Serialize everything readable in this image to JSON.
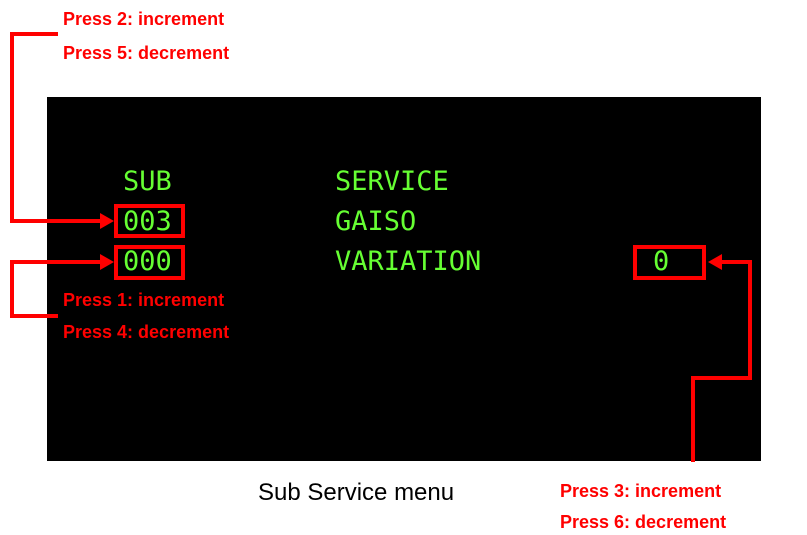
{
  "colors": {
    "screen_background": "#000000",
    "screen_text": "#66ff33",
    "annotation": "#ff0000",
    "caption": "#000000"
  },
  "screen": {
    "column_sub_header": "SUB",
    "column_service_header": "SERVICE",
    "sub_value_1": "003",
    "service_item_1": "GAISO",
    "sub_value_2": "000",
    "service_item_2": "VARIATION",
    "variation_value": "0"
  },
  "annotations": {
    "top_left": [
      "Press 2: increment",
      "Press 5: decrement"
    ],
    "middle_left": [
      "Press 1: increment",
      "Press 4: decrement"
    ],
    "bottom_right": [
      "Press 3: increment",
      "Press 6: decrement"
    ]
  },
  "caption": "Sub Service menu"
}
